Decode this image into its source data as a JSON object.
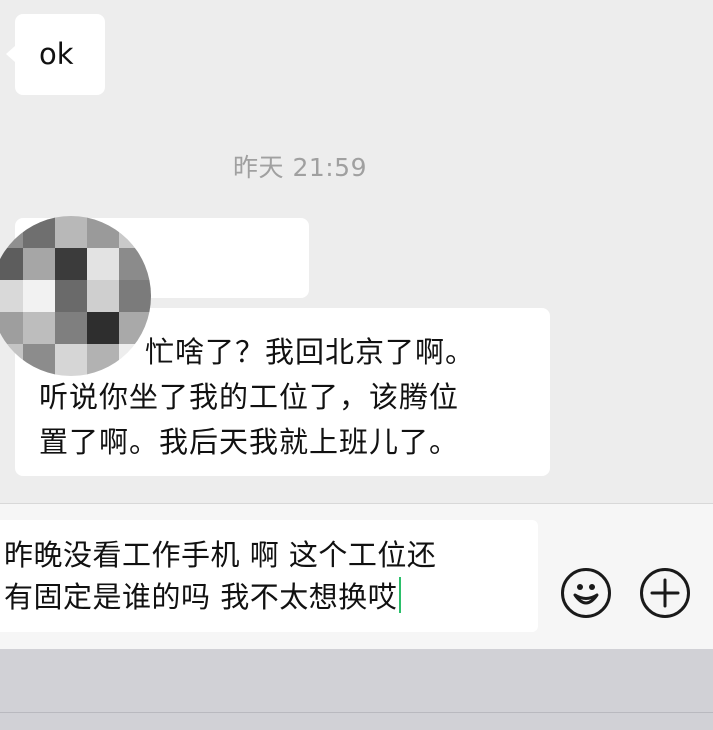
{
  "messages": {
    "first_reply": "ok",
    "timestamp": "昨天 21:59",
    "incoming_line_1": "忙啥了？我回北京了啊。",
    "incoming_line_2": "听说你坐了我的工位了，该腾位",
    "incoming_line_3": "置了啊。我后天我就上班儿了。"
  },
  "composer": {
    "draft_line_1": "昨晚没看工作手机 啊 这个工位还",
    "draft_line_2": "有固定是谁的吗 我不太想换哎",
    "emoji_icon": "emoji-smile-icon",
    "plus_icon": "plus-circle-icon"
  },
  "colors": {
    "chat_background": "#ededed",
    "bubble": "#ffffff",
    "caret": "#2bbf6a",
    "keyboard_panel": "#d1d1d6"
  }
}
